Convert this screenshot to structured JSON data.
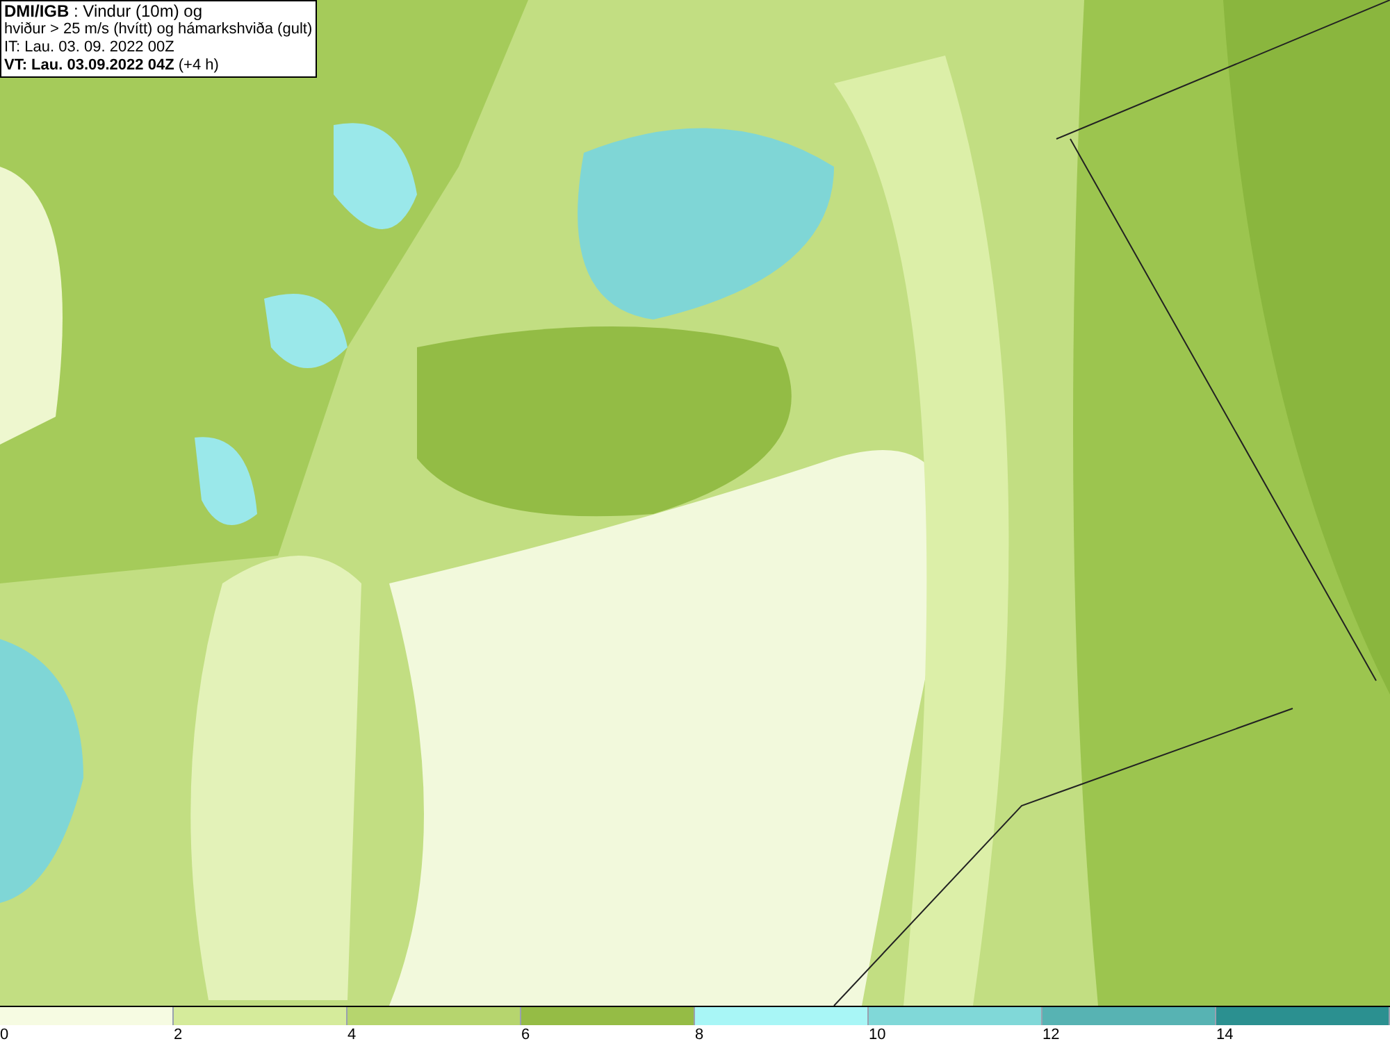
{
  "info_box": {
    "lines": [
      "**DMI/IGB** : Vindur (10m) og",
      "hviður > 25 m/s (hvítt) og hámarkshviða (gult)",
      "IT: Lau. 03. 09. 2022 00Z",
      "**VT: Lau. 03.09.2022 04Z** (+4 h)"
    ]
  },
  "legend": [
    {
      "label": "0",
      "color": "#f6fbe2"
    },
    {
      "label": "2",
      "color": "#d5eb9b"
    },
    {
      "label": "4",
      "color": "#b6d56e"
    },
    {
      "label": "6",
      "color": "#95bc45"
    },
    {
      "label": "8",
      "color": "#a8f6f6"
    },
    {
      "label": "10",
      "color": "#80d8d8"
    },
    {
      "label": "12",
      "color": "#57b3b3"
    },
    {
      "label": "14",
      "color": "#2b9090"
    }
  ]
}
